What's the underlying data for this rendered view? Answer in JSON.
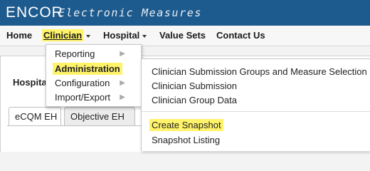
{
  "brand": {
    "logo": "ENCOR",
    "subtitle": "Electronic Measures"
  },
  "nav": {
    "items": [
      {
        "label": "Home"
      },
      {
        "label": "Clinician"
      },
      {
        "label": "Hospital"
      },
      {
        "label": "Value Sets"
      },
      {
        "label": "Contact Us"
      }
    ]
  },
  "content": {
    "title": "Hospita",
    "tabs": [
      {
        "label": "eCQM EH"
      },
      {
        "label": "Objective EH"
      }
    ]
  },
  "dropdown": {
    "items": [
      {
        "label": "Reporting"
      },
      {
        "label": "Administration"
      },
      {
        "label": "Configuration"
      },
      {
        "label": "Import/Export"
      }
    ]
  },
  "submenu": {
    "items": [
      {
        "label": "Clinician Submission Groups and Measure Selection"
      },
      {
        "label": "Clinician Submission"
      },
      {
        "label": "Clinician Group Data"
      },
      {
        "label": "Create Snapshot"
      },
      {
        "label": "Snapshot Listing"
      }
    ]
  },
  "colors": {
    "brand_bar": "#1d5a8d",
    "highlight": "#fff36a"
  }
}
